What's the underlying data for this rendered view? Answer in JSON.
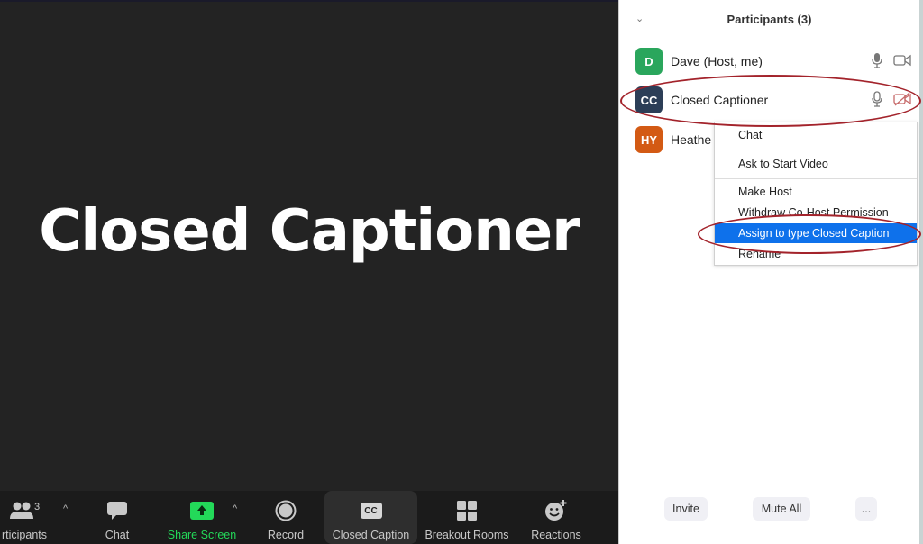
{
  "video": {
    "speaker_name": "Closed Captioner"
  },
  "toolbar": {
    "items": [
      {
        "label": "Participants",
        "label_visible": "rticipants",
        "count": "3",
        "icon": "participants-icon"
      },
      {
        "label": "Chat",
        "icon": "chat-icon"
      },
      {
        "label": "Share Screen",
        "icon": "share-screen-icon",
        "color": "#23d959"
      },
      {
        "label": "Record",
        "icon": "record-icon"
      },
      {
        "label": "Closed Caption",
        "icon": "cc-icon",
        "icon_text": "CC",
        "active": true
      },
      {
        "label": "Breakout Rooms",
        "icon": "breakout-rooms-icon"
      },
      {
        "label": "Reactions",
        "icon": "reactions-icon"
      }
    ],
    "caret": "^"
  },
  "panel": {
    "title": "Participants (3)",
    "participants": [
      {
        "initials": "D",
        "name": "Dave (Host, me)",
        "color": "#2aa65c",
        "mic": "on",
        "video": "on"
      },
      {
        "initials": "CC",
        "name": "Closed Captioner",
        "color": "#2c3e57",
        "mic": "on",
        "video": "off"
      },
      {
        "initials": "HY",
        "name": "Heathe",
        "color": "#d35a14"
      }
    ],
    "context_menu": {
      "items": [
        {
          "label": "Chat"
        },
        {
          "label": "Ask to Start Video"
        },
        {
          "label": "Make Host"
        },
        {
          "label": "Withdraw Co-Host Permission"
        },
        {
          "label": "Assign to type Closed Caption",
          "highlighted": true
        },
        {
          "label": "Rename"
        }
      ]
    },
    "footer": {
      "invite": "Invite",
      "mute_all": "Mute All",
      "more": "..."
    }
  },
  "colors": {
    "highlight": "#0e71eb",
    "annotation": "#a3232b",
    "share_green": "#23d959"
  }
}
